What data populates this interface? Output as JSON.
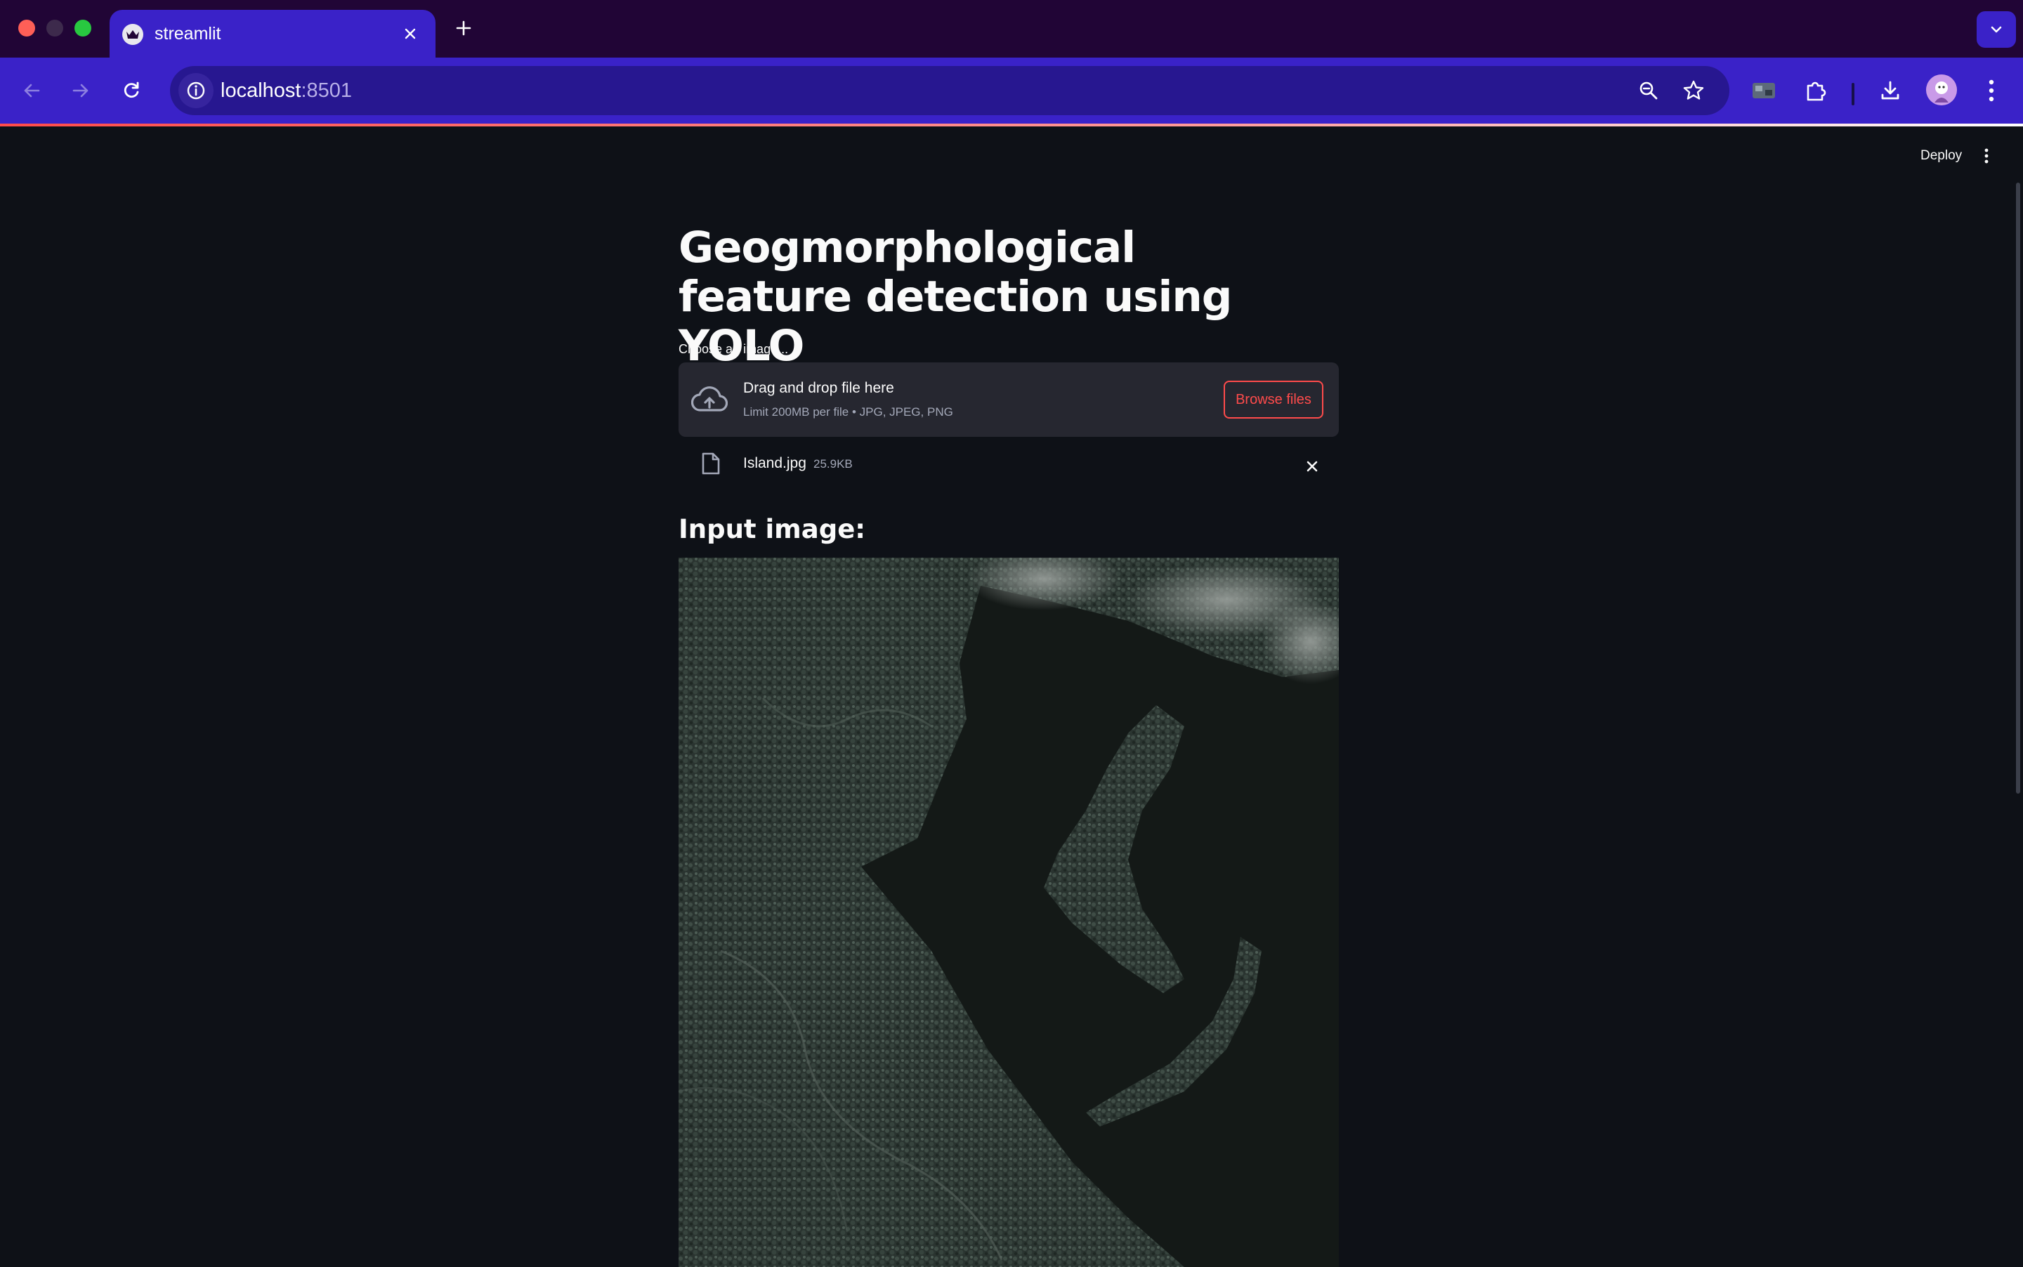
{
  "browser": {
    "tab_title": "streamlit",
    "url_host": "localhost",
    "url_port": ":8501"
  },
  "app": {
    "deploy_label": "Deploy",
    "title": "Geogmorphological feature detection using YOLO",
    "uploader": {
      "label": "Choose an image...",
      "drop_text": "Drag and drop file here",
      "limit_text": "Limit 200MB per file • JPG, JPEG, PNG",
      "browse_label": "Browse files"
    },
    "file": {
      "name": "Island.jpg",
      "size": "25.9KB"
    },
    "subheader": "Input image:"
  },
  "colors": {
    "background": "#0e1117",
    "accent": "#ff4b4b",
    "browser_chrome": "#3a22c8",
    "tabbar": "#210536"
  }
}
